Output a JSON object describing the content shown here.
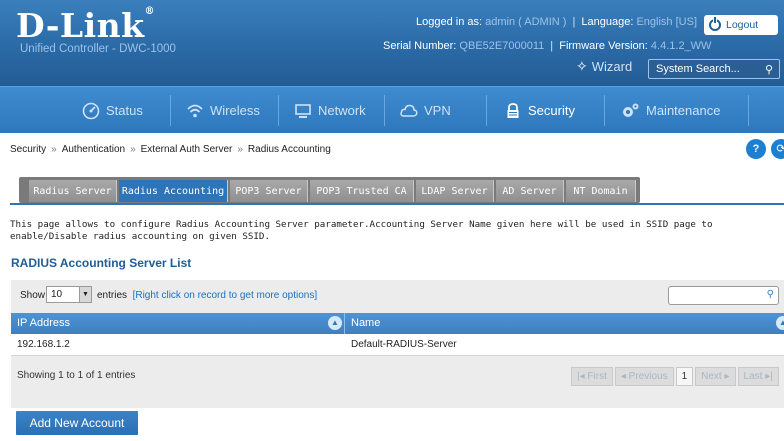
{
  "header": {
    "logo": "D-Link",
    "logo_mark": "®",
    "subtitle": "Unified Controller - DWC-1000",
    "logged_in_label": "Logged in as:",
    "logged_in_value": "admin ( ADMIN )",
    "language_label": "Language:",
    "language_value": "English [US]",
    "logout_label": "Logout",
    "serial_label": "Serial Number:",
    "serial_value": "QBE52E7000011",
    "firmware_label": "Firmware Version:",
    "firmware_value": "4.4.1.2_WW",
    "wizard_label": "Wizard",
    "search_placeholder": "System Search..."
  },
  "nav": {
    "items": [
      {
        "label": "Status",
        "icon": "dashboard-icon"
      },
      {
        "label": "Wireless",
        "icon": "wifi-icon"
      },
      {
        "label": "Network",
        "icon": "monitor-icon"
      },
      {
        "label": "VPN",
        "icon": "cloud-icon"
      },
      {
        "label": "Security",
        "icon": "lock-icon"
      },
      {
        "label": "Maintenance",
        "icon": "gears-icon"
      }
    ],
    "active": "Security"
  },
  "breadcrumb": [
    "Security",
    "Authentication",
    "External Auth Server",
    "Radius Accounting"
  ],
  "breadcrumb_sep": "»",
  "tabs": [
    {
      "label": "Radius Server"
    },
    {
      "label": "Radius Accounting"
    },
    {
      "label": "POP3 Server"
    },
    {
      "label": "POP3 Trusted CA"
    },
    {
      "label": "LDAP Server"
    },
    {
      "label": "AD Server"
    },
    {
      "label": "NT Domain"
    }
  ],
  "description": "This page allows to configure Radius Accounting Server parameter.Accounting Server Name given here will be used in SSID page to enable/Disable radius accounting on given SSID.",
  "section_title": "RADIUS Accounting Server List",
  "table": {
    "show_label": "Show",
    "entries_value": "10",
    "entries_label": "entries",
    "hint": "[Right click on record to get more options]",
    "columns": [
      "IP Address",
      "Name"
    ],
    "rows": [
      {
        "ip": "192.168.1.2",
        "name": "Default-RADIUS-Server"
      }
    ],
    "showing": "Showing 1 to 1 of 1 entries",
    "pager": {
      "first": "First",
      "previous": "Previous",
      "current": "1",
      "next": "Next",
      "last": "Last"
    }
  },
  "add_button": "Add New Account",
  "colors": {
    "header": "#2a6aa6",
    "nav": "#3f8cd0",
    "accent": "#2d74b8",
    "title": "#1f5d97"
  }
}
